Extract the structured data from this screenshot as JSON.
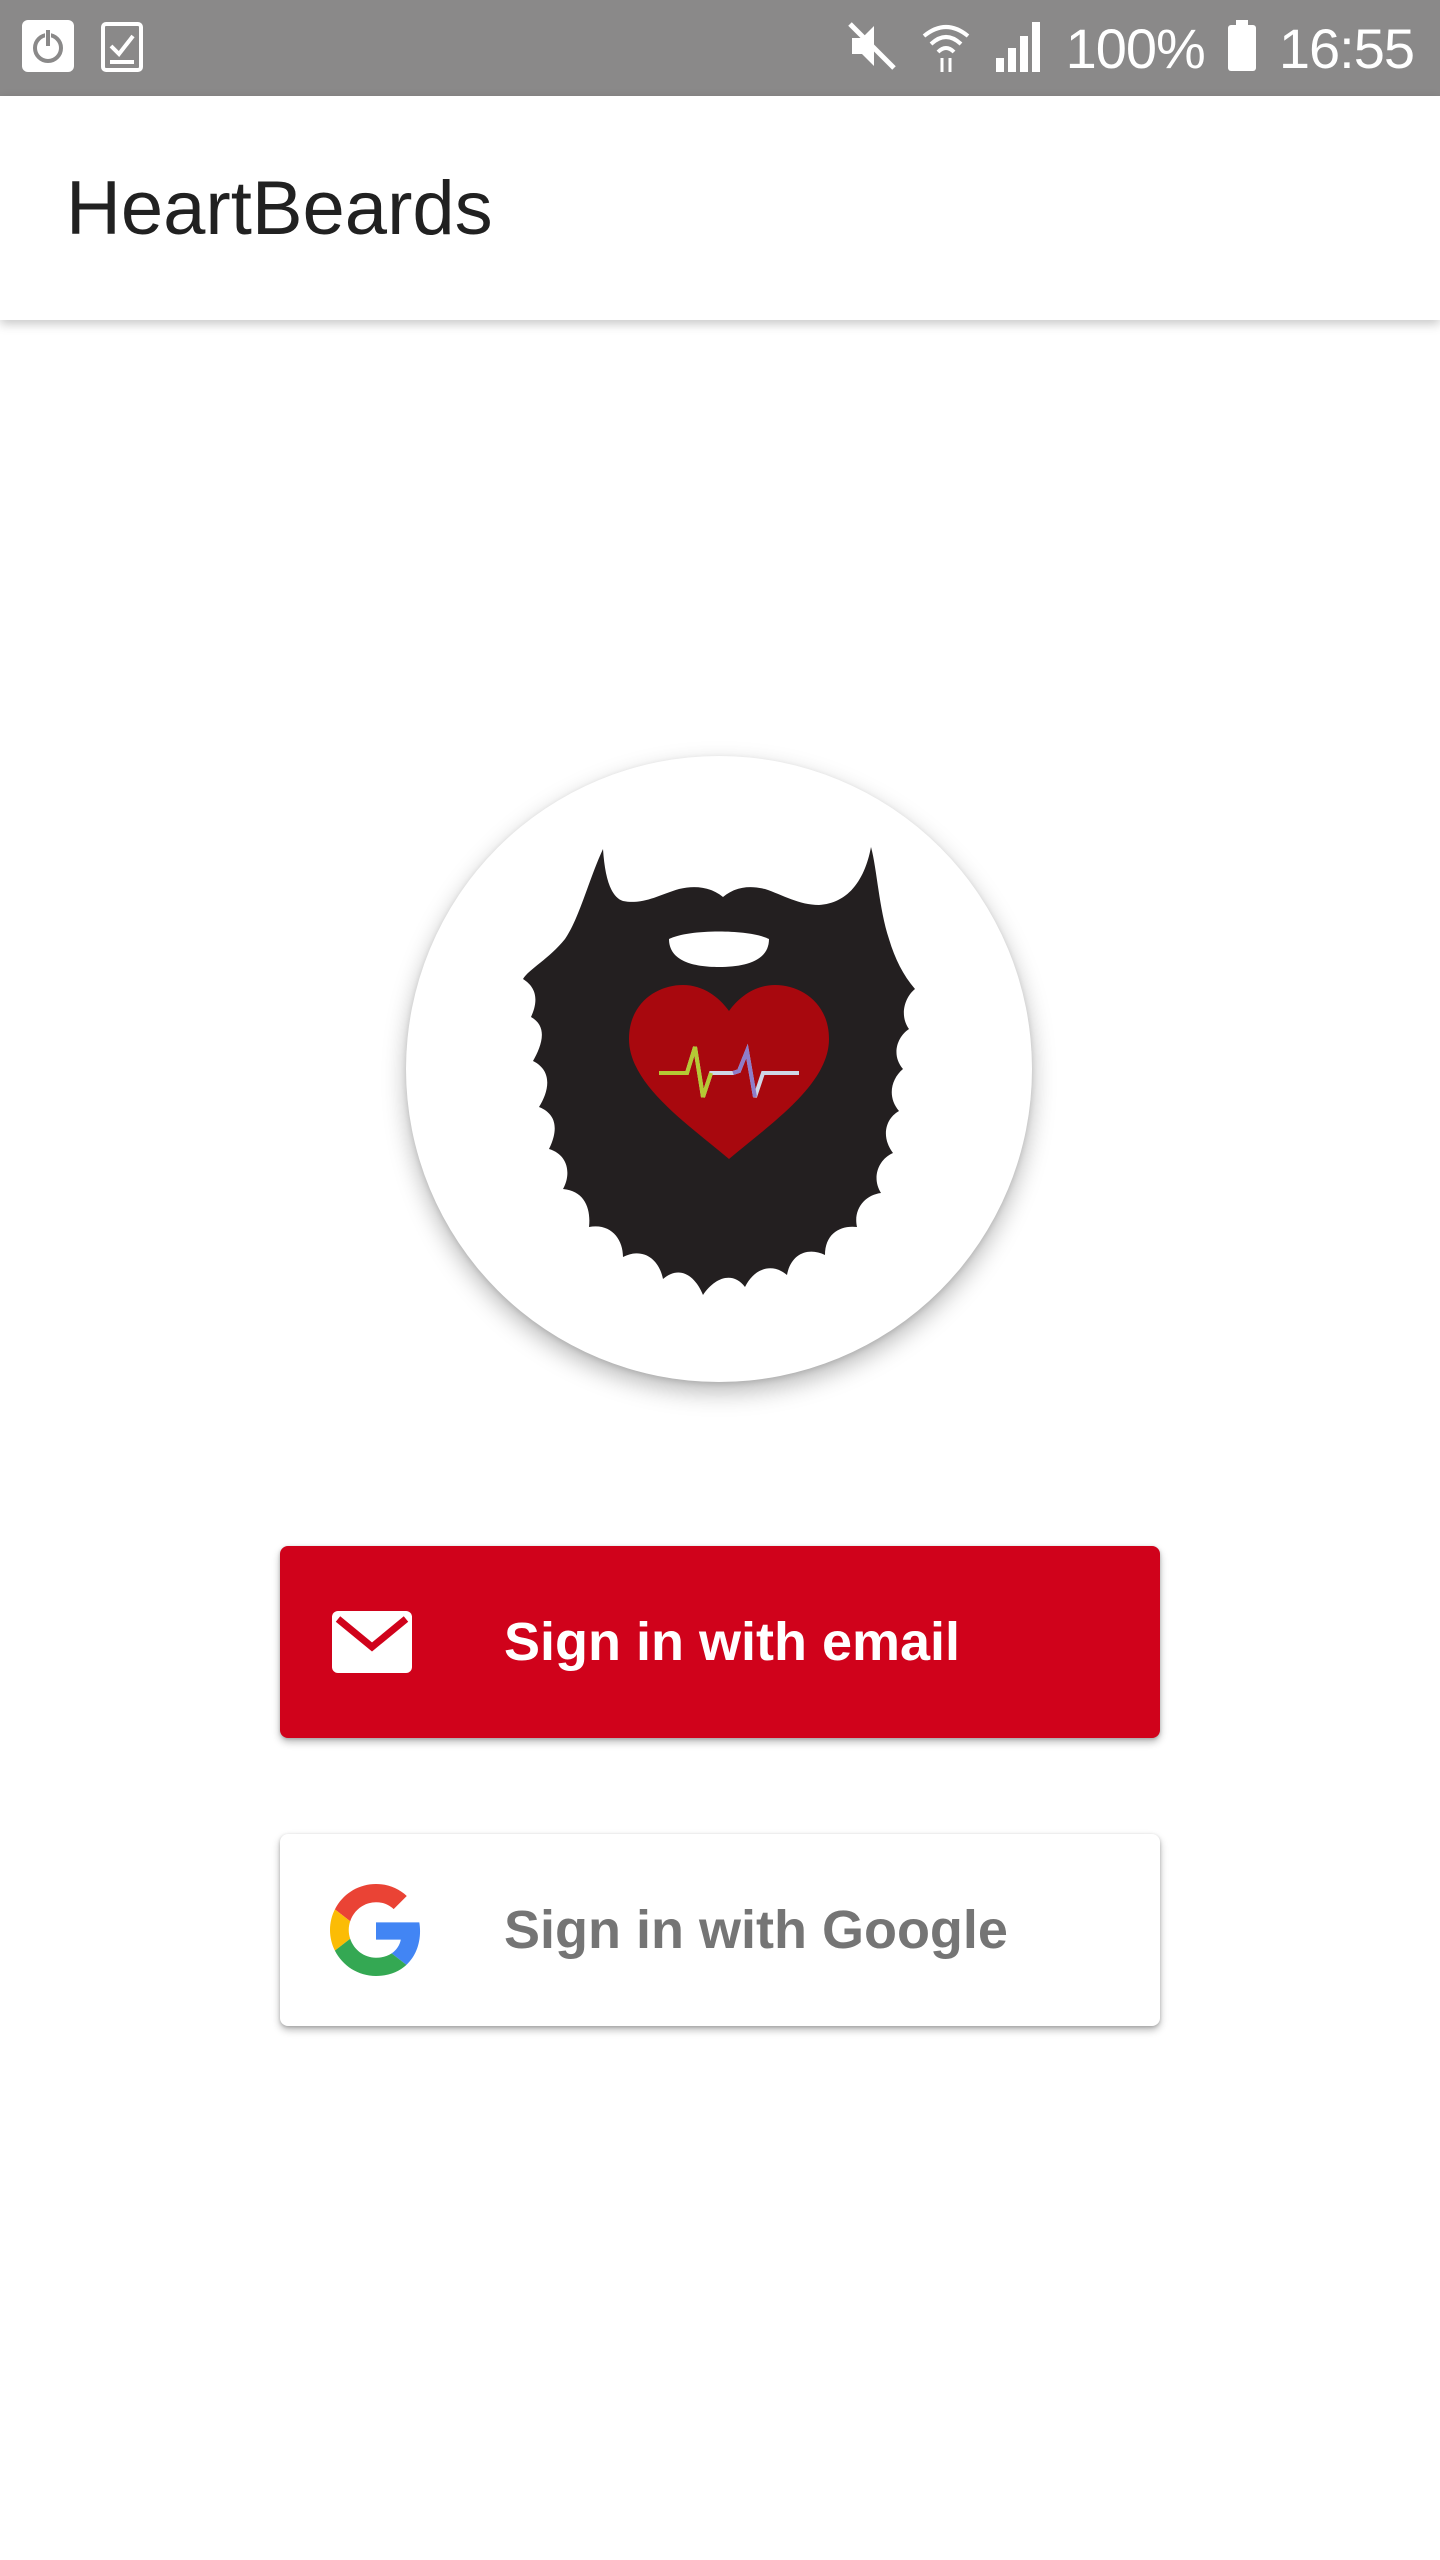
{
  "status_bar": {
    "battery": "100%",
    "time": "16:55"
  },
  "app_bar": {
    "title": "HeartBeards"
  },
  "buttons": {
    "email_label": "Sign in with email",
    "google_label": "Sign in with Google"
  },
  "colors": {
    "email_button": "#d0021b",
    "status_bar": "#8a8989"
  },
  "icons": {
    "email": "mail-icon",
    "google": "google-logo-icon",
    "logo": "beard-heart-logo"
  }
}
